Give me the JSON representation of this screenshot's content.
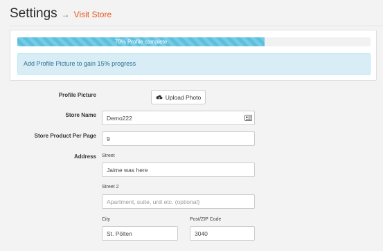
{
  "header": {
    "title": "Settings",
    "arrow": "→",
    "visit_store_label": "Visit Store"
  },
  "progress": {
    "percent": 70,
    "label": "70% Profile complete",
    "color": "#5bc0de"
  },
  "alert": {
    "text": "Add Profile Picture to gain 15% progress"
  },
  "form": {
    "profile_picture": {
      "label": "Profile Picture",
      "button_label": "Upload Photo",
      "button_icon": "cloud-upload-icon"
    },
    "store_name": {
      "label": "Store Name",
      "value": "Demo222",
      "icon": "contact-card-icon"
    },
    "products_per_page": {
      "label": "Store Product Per Page",
      "value": "9"
    },
    "address": {
      "label": "Address",
      "street": {
        "label": "Street",
        "value": "Jaime was here"
      },
      "street2": {
        "label": "Street 2",
        "value": "",
        "placeholder": "Apartment, suite, unit etc. (optional)"
      },
      "city": {
        "label": "City",
        "value": "St. Pölten"
      },
      "zip": {
        "label": "Post/ZIP Code",
        "value": "3040"
      }
    }
  },
  "colors": {
    "accent": "#e8551d",
    "alert_bg": "#d9edf7",
    "alert_text": "#31708f"
  }
}
